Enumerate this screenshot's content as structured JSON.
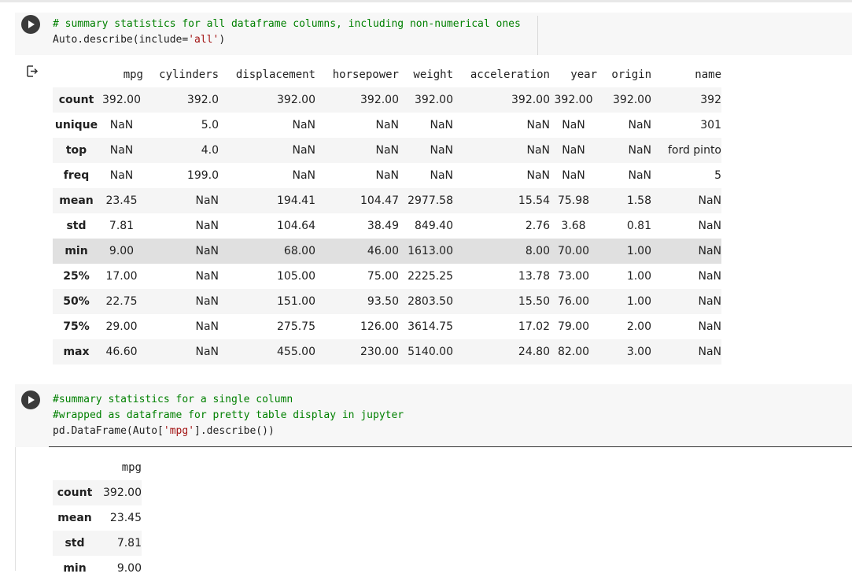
{
  "cell1": {
    "code_line1": "# summary statistics for all dataframe columns, including non-numerical ones",
    "code_line2_pre": "Auto.describe(include=",
    "code_line2_str": "'all'",
    "code_line2_post": ")"
  },
  "table1": {
    "columns": [
      "mpg",
      "cylinders",
      "displacement",
      "horsepower",
      "weight",
      "acceleration",
      "year",
      "origin",
      "name"
    ],
    "rows": [
      {
        "index": "count",
        "values": [
          "392.00",
          "392.0",
          "392.00",
          "392.00",
          "392.00",
          "392.00",
          "392.00",
          "392.00",
          "392"
        ]
      },
      {
        "index": "unique",
        "values": [
          "NaN",
          "5.0",
          "NaN",
          "NaN",
          "NaN",
          "NaN",
          "NaN",
          "NaN",
          "301"
        ]
      },
      {
        "index": "top",
        "values": [
          "NaN",
          "4.0",
          "NaN",
          "NaN",
          "NaN",
          "NaN",
          "NaN",
          "NaN",
          "ford pinto"
        ]
      },
      {
        "index": "freq",
        "values": [
          "NaN",
          "199.0",
          "NaN",
          "NaN",
          "NaN",
          "NaN",
          "NaN",
          "NaN",
          "5"
        ]
      },
      {
        "index": "mean",
        "values": [
          "23.45",
          "NaN",
          "194.41",
          "104.47",
          "2977.58",
          "15.54",
          "75.98",
          "1.58",
          "NaN"
        ]
      },
      {
        "index": "std",
        "values": [
          "7.81",
          "NaN",
          "104.64",
          "38.49",
          "849.40",
          "2.76",
          "3.68",
          "0.81",
          "NaN"
        ]
      },
      {
        "index": "min",
        "values": [
          "9.00",
          "NaN",
          "68.00",
          "46.00",
          "1613.00",
          "8.00",
          "70.00",
          "1.00",
          "NaN"
        ]
      },
      {
        "index": "25%",
        "values": [
          "17.00",
          "NaN",
          "105.00",
          "75.00",
          "2225.25",
          "13.78",
          "73.00",
          "1.00",
          "NaN"
        ]
      },
      {
        "index": "50%",
        "values": [
          "22.75",
          "NaN",
          "151.00",
          "93.50",
          "2803.50",
          "15.50",
          "76.00",
          "1.00",
          "NaN"
        ]
      },
      {
        "index": "75%",
        "values": [
          "29.00",
          "NaN",
          "275.75",
          "126.00",
          "3614.75",
          "17.02",
          "79.00",
          "2.00",
          "NaN"
        ]
      },
      {
        "index": "max",
        "values": [
          "46.60",
          "NaN",
          "455.00",
          "230.00",
          "5140.00",
          "24.80",
          "82.00",
          "3.00",
          "NaN"
        ]
      }
    ]
  },
  "cell2": {
    "code_line1": "#summary statistics for a single column",
    "code_line2": "#wrapped as dataframe for pretty table display in jupyter",
    "code_line3_pre": "pd.DataFrame(Auto[",
    "code_line3_str": "'mpg'",
    "code_line3_post": "].describe())"
  },
  "table2": {
    "columns": [
      "mpg"
    ],
    "rows": [
      {
        "index": "count",
        "values": [
          "392.00"
        ]
      },
      {
        "index": "mean",
        "values": [
          "23.45"
        ]
      },
      {
        "index": "std",
        "values": [
          "7.81"
        ]
      },
      {
        "index": "min",
        "values": [
          "9.00"
        ]
      }
    ]
  },
  "icons": {
    "run": "play-icon",
    "output": "output-arrow-icon"
  }
}
